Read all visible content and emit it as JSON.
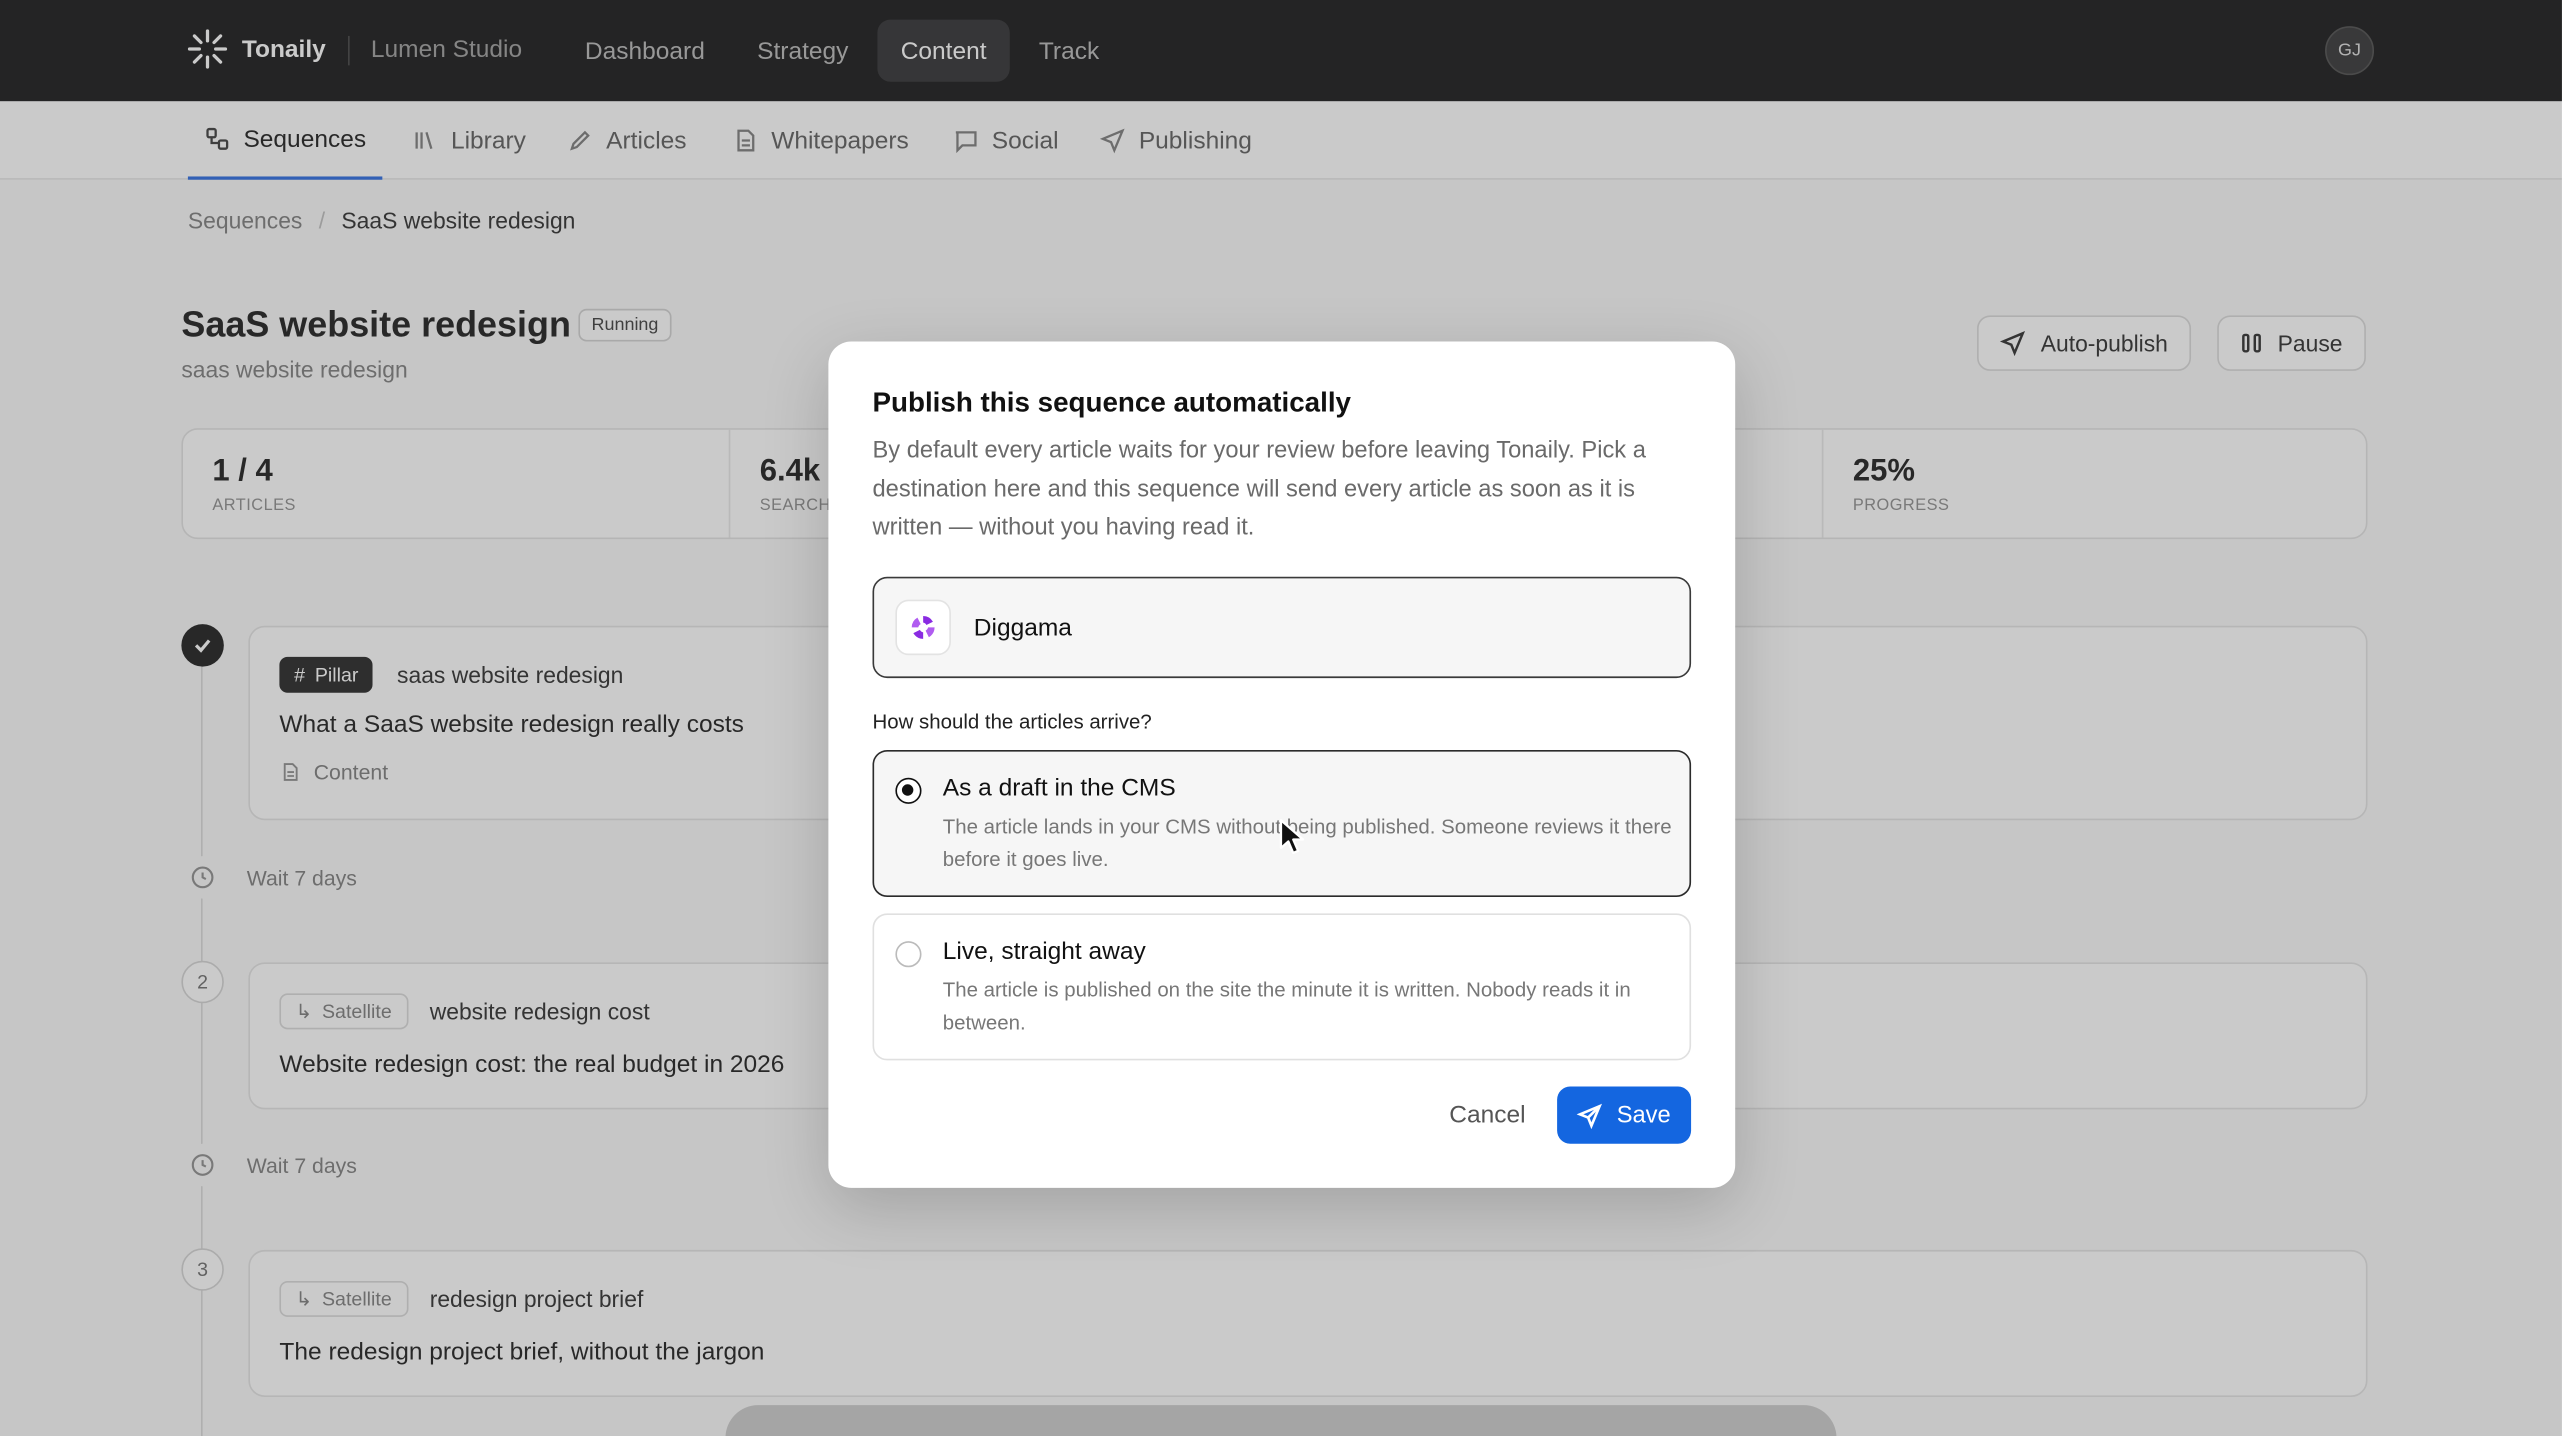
{
  "app": {
    "brand": "Tonaily",
    "workspace": "Lumen Studio",
    "avatar_initials": "GJ"
  },
  "topnav": [
    {
      "label": "Dashboard",
      "active": false
    },
    {
      "label": "Strategy",
      "active": false
    },
    {
      "label": "Content",
      "active": true
    },
    {
      "label": "Track",
      "active": false
    }
  ],
  "subnav": {
    "sequences": "Sequences",
    "library": "Library",
    "articles": "Articles",
    "whitepapers": "Whitepapers",
    "social": "Social",
    "publishing": "Publishing"
  },
  "breadcrumb": {
    "root": "Sequences",
    "separator": "/",
    "current": "SaaS website redesign"
  },
  "page": {
    "title": "SaaS website redesign",
    "status": "Running",
    "subtitle": "saas website redesign",
    "autopublish_label": "Auto-publish",
    "pause_label": "Pause"
  },
  "stats": [
    {
      "value": "1 / 4",
      "label": "ARTICLES"
    },
    {
      "value": "6.4k",
      "label": "SEARCH"
    },
    {
      "value": "25%",
      "label": "PROGRESS"
    }
  ],
  "timeline": {
    "step1": {
      "tag": "Pillar",
      "keyword": "saas website redesign",
      "title": "What a SaaS website redesign really costs",
      "meta": "Content"
    },
    "wait1": "Wait 7 days",
    "step2": {
      "number": "2",
      "tag": "Satellite",
      "keyword": "website redesign cost",
      "title": "Website redesign cost: the real budget in 2026"
    },
    "wait2": "Wait 7 days",
    "step3": {
      "number": "3",
      "tag": "Satellite",
      "keyword": "redesign project brief",
      "title": "The redesign project brief, without the jargon"
    }
  },
  "modal": {
    "title": "Publish this sequence automatically",
    "description": "By default every article waits for your review before leaving Tonaily. Pick a destination here and this sequence will send every article as soon as it is written — without you having read it.",
    "destination": "Diggama",
    "question": "How should the articles arrive?",
    "options": [
      {
        "title": "As a draft in the CMS",
        "description": "The article lands in your CMS without being published. Someone reviews it there before it goes live.",
        "selected": true
      },
      {
        "title": "Live, straight away",
        "description": "The article is published on the site the minute it is written. Nobody reads it in between.",
        "selected": false
      }
    ],
    "cancel_label": "Cancel",
    "save_label": "Save"
  },
  "colors": {
    "accent": "#1466e0",
    "topbar": "#0b0b0c",
    "brand_logo": "#8a2be2"
  }
}
